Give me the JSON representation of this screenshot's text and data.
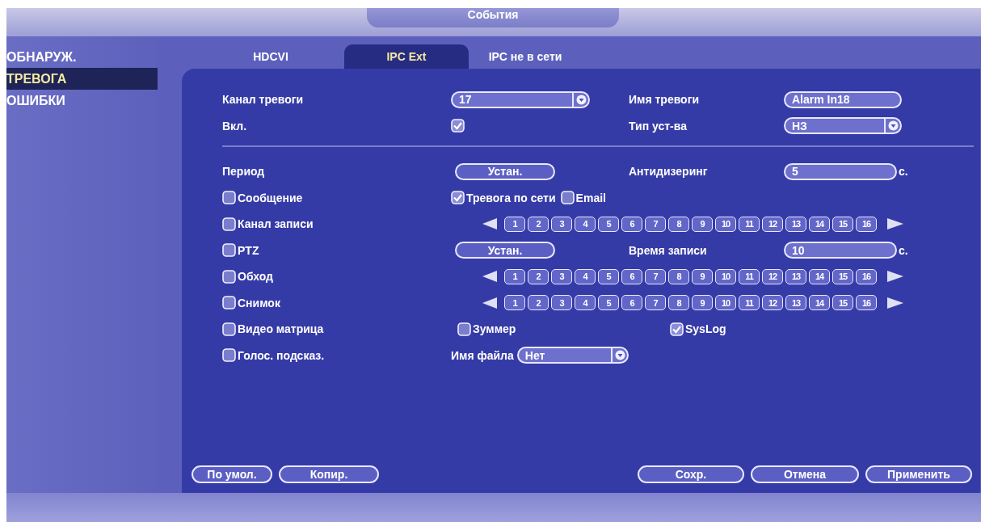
{
  "header": {
    "title": "События"
  },
  "sidebar": {
    "items": [
      {
        "label": "ОБНАРУЖ.",
        "selected": false
      },
      {
        "label": "ТРЕВОГА",
        "selected": true
      },
      {
        "label": "ОШИБКИ",
        "selected": false
      }
    ]
  },
  "tabs": [
    {
      "label": "HDCVI",
      "selected": false
    },
    {
      "label": "IPC Ext",
      "selected": true
    },
    {
      "label": "IPC не в сети",
      "selected": false
    }
  ],
  "form": {
    "rows": [
      {
        "cells": [
          [
            {
              "kind": "label",
              "text": "Канал тревоги"
            }
          ],
          [
            {
              "kind": "dropdown",
              "value": "17"
            }
          ],
          [
            {
              "kind": "label",
              "text": "Имя тревоги"
            }
          ],
          [
            {
              "kind": "field",
              "value": "Alarm In18"
            }
          ]
        ]
      },
      {
        "cells": [
          [
            {
              "kind": "label",
              "text": "Вкл."
            }
          ],
          [
            {
              "kind": "checkbox",
              "checked": true
            }
          ],
          [
            {
              "kind": "label",
              "text": "Тип уст-ва"
            }
          ],
          [
            {
              "kind": "dropdown",
              "value": "НЗ"
            }
          ]
        ]
      },
      {
        "kind": "divider"
      },
      {
        "cells": [
          [
            {
              "kind": "label",
              "text": "Период"
            }
          ],
          [
            {
              "kind": "button",
              "text": "Устан."
            }
          ],
          [
            {
              "kind": "label",
              "text": "Антидизеринг"
            }
          ],
          [
            {
              "kind": "field",
              "value": "5"
            },
            {
              "kind": "unit",
              "text": "с."
            }
          ]
        ]
      },
      {
        "cells": [
          [
            {
              "kind": "checkbox",
              "checked": false,
              "text": "Сообщение"
            }
          ],
          [
            {
              "kind": "checkbox",
              "checked": true,
              "text": "Тревога по сети"
            },
            {
              "kind": "checkbox",
              "checked": false,
              "text": "Email"
            }
          ]
        ]
      },
      {
        "cells": [
          [
            {
              "kind": "checkbox",
              "checked": false,
              "text": "Канал записи"
            }
          ],
          [
            {
              "kind": "channels",
              "labels": [
                "1",
                "2",
                "3",
                "4",
                "5",
                "6",
                "7",
                "8",
                "9",
                "10",
                "11",
                "12",
                "13",
                "14",
                "15",
                "16"
              ]
            }
          ]
        ]
      },
      {
        "cells": [
          [
            {
              "kind": "checkbox",
              "checked": false,
              "text": "PTZ"
            }
          ],
          [
            {
              "kind": "button",
              "text": "Устан."
            }
          ],
          [
            {
              "kind": "label",
              "text": "Время записи"
            }
          ],
          [
            {
              "kind": "field",
              "value": "10"
            },
            {
              "kind": "unit",
              "text": "с."
            }
          ]
        ]
      },
      {
        "cells": [
          [
            {
              "kind": "checkbox",
              "checked": false,
              "text": "Обход"
            }
          ],
          [
            {
              "kind": "channels",
              "labels": [
                "1",
                "2",
                "3",
                "4",
                "5",
                "6",
                "7",
                "8",
                "9",
                "10",
                "11",
                "12",
                "13",
                "14",
                "15",
                "16"
              ]
            }
          ]
        ]
      },
      {
        "cells": [
          [
            {
              "kind": "checkbox",
              "checked": false,
              "text": "Снимок"
            }
          ],
          [
            {
              "kind": "channels",
              "labels": [
                "1",
                "2",
                "3",
                "4",
                "5",
                "6",
                "7",
                "8",
                "9",
                "10",
                "11",
                "12",
                "13",
                "14",
                "15",
                "16"
              ]
            }
          ]
        ]
      },
      {
        "cells": [
          [
            {
              "kind": "checkbox",
              "checked": false,
              "text": "Видео матрица"
            }
          ],
          [
            {
              "kind": "checkbox",
              "checked": false,
              "text": "Зуммер"
            }
          ],
          [
            {
              "kind": "checkbox",
              "checked": true,
              "text": "SysLog"
            }
          ]
        ]
      },
      {
        "cells": [
          [
            {
              "kind": "checkbox",
              "checked": false,
              "text": "Голос. подсказ."
            }
          ],
          [
            {
              "kind": "label",
              "text": "Имя файла"
            },
            {
              "kind": "dropdown",
              "value": "Нет"
            }
          ]
        ]
      }
    ]
  },
  "footer": {
    "left_buttons": [
      "По умол.",
      "Копир."
    ],
    "right_buttons": [
      "Сохр.",
      "Отмена",
      "Применить"
    ]
  }
}
